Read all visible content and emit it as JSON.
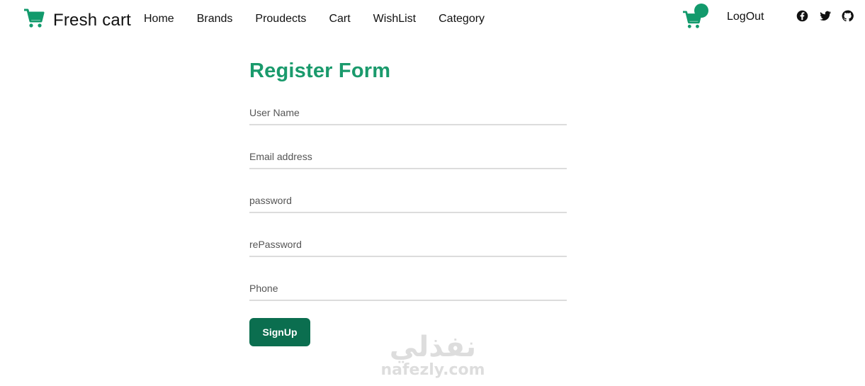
{
  "brand": {
    "name": "Fresh cart",
    "icon": "shopping-cart-icon",
    "accent_color": "#129a6c"
  },
  "nav": {
    "links": [
      "Home",
      "Brands",
      "Proudects",
      "Cart",
      "WishList",
      "Category"
    ],
    "logout_label": "LogOut",
    "cart_badge": "",
    "social_icons": [
      "facebook-icon",
      "twitter-icon",
      "github-icon"
    ]
  },
  "form": {
    "title": "Register Form",
    "title_color": "#1a9a6c",
    "fields": [
      {
        "placeholder": "User Name"
      },
      {
        "placeholder": "Email address"
      },
      {
        "placeholder": "password"
      },
      {
        "placeholder": "rePassword"
      },
      {
        "placeholder": "Phone"
      }
    ],
    "submit_label": "SignUp",
    "submit_color": "#0b6e4f"
  },
  "watermark": {
    "arabic": "نفذلي",
    "latin": "nafezly.com"
  }
}
